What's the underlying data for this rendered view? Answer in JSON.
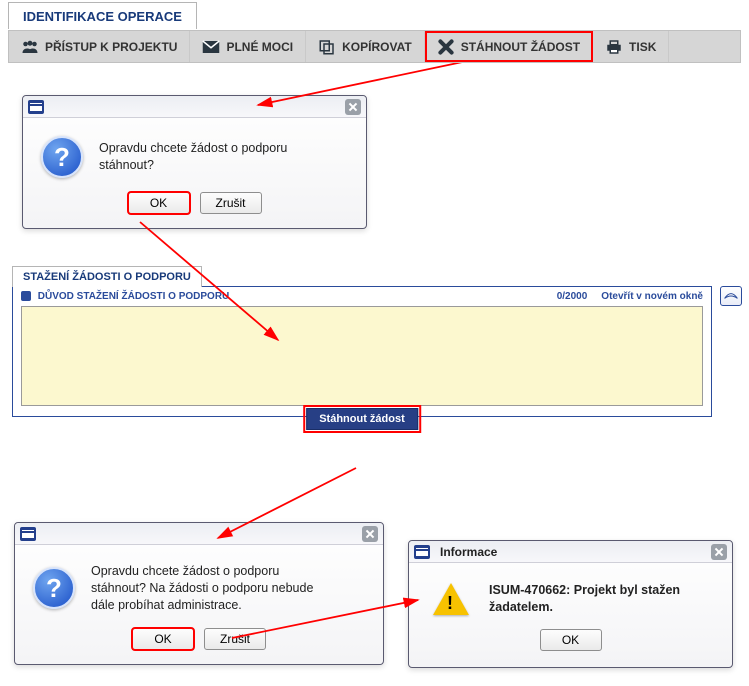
{
  "header": {
    "title": "IDENTIFIKACE OPERACE"
  },
  "toolbar": {
    "access": "PŘÍSTUP K PROJEKTU",
    "powers": "PLNÉ MOCI",
    "copy": "KOPÍROVAT",
    "withdraw": "STÁHNOUT ŽÁDOST",
    "print": "TISK"
  },
  "dialog1": {
    "text": "Opravdu chcete žádost o podporu stáhnout?",
    "ok": "OK",
    "cancel": "Zrušit"
  },
  "panel": {
    "tab": "STAŽENÍ ŽÁDOSTI O PODPORU",
    "field_label": "DŮVOD STAŽENÍ ŽÁDOSTI O PODPORU",
    "counter": "0/2000",
    "open_new": "Otevřít v novém okně",
    "value": "",
    "submit": "Stáhnout žádost"
  },
  "dialog2": {
    "text": "Opravdu chcete žádost o podporu stáhnout? Na žádosti o podporu nebude dále probíhat administrace.",
    "ok": "OK",
    "cancel": "Zrušit"
  },
  "info_dialog": {
    "title": "Informace",
    "text": "ISUM-470662: Projekt byl stažen žadatelem.",
    "ok": "OK"
  }
}
